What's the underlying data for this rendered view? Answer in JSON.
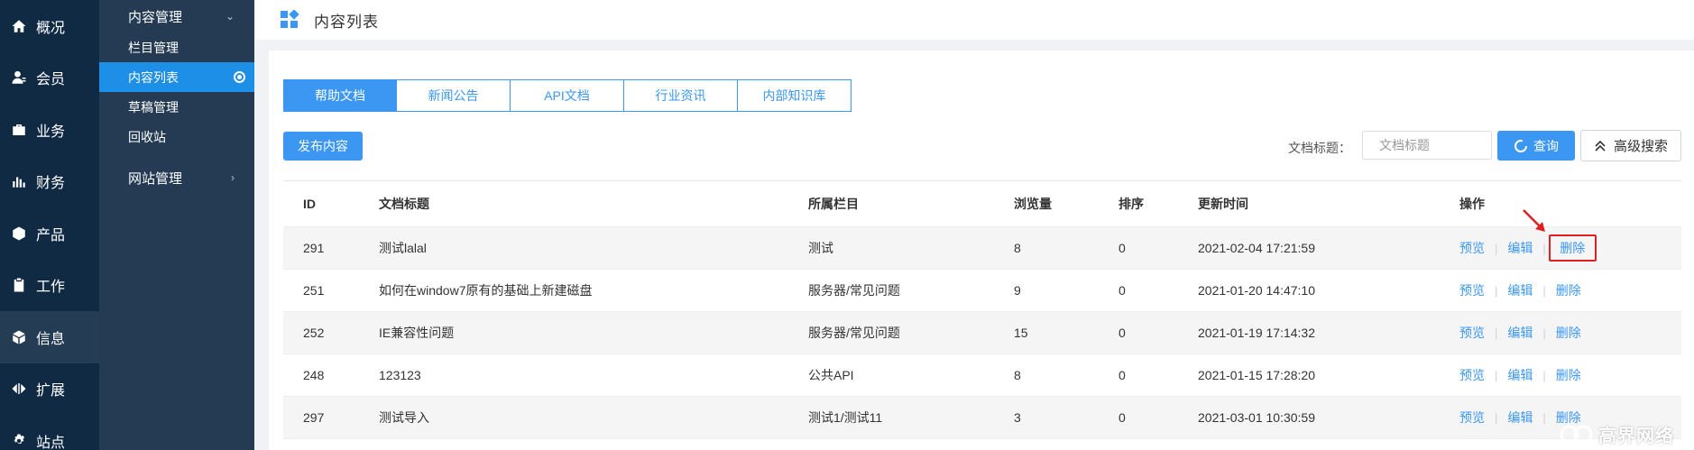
{
  "rail": [
    {
      "label": "概况",
      "icon": "home-icon"
    },
    {
      "label": "会员",
      "icon": "user-icon"
    },
    {
      "label": "业务",
      "icon": "briefcase-icon"
    },
    {
      "label": "财务",
      "icon": "bar-chart-icon"
    },
    {
      "label": "产品",
      "icon": "cube-icon"
    },
    {
      "label": "工作",
      "icon": "clipboard-icon"
    },
    {
      "label": "信息",
      "icon": "box-icon",
      "active": true
    },
    {
      "label": "扩展",
      "icon": "expand-icon"
    },
    {
      "label": "站点",
      "icon": "gear-icon"
    }
  ],
  "submenu": {
    "content_group": "内容管理",
    "items": [
      "栏目管理",
      "内容列表",
      "草稿管理",
      "回收站"
    ],
    "active_item": "内容列表",
    "site_group": "网站管理"
  },
  "header": {
    "title": "内容列表"
  },
  "tabs": [
    "帮助文档",
    "新闻公告",
    "API文档",
    "行业资讯",
    "内部知识库"
  ],
  "active_tab": "帮助文档",
  "toolbar": {
    "publish_label": "发布内容",
    "search_label": "文档标题：",
    "search_placeholder": "文档标题",
    "query_label": "查询",
    "advanced_label": "高级搜索"
  },
  "table": {
    "headers": [
      "ID",
      "文档标题",
      "所属栏目",
      "浏览量",
      "排序",
      "更新时间",
      "操作"
    ],
    "ops": {
      "preview": "预览",
      "edit": "编辑",
      "delete": "删除"
    },
    "rows": [
      {
        "id": "291",
        "title": "测试lalal",
        "column": "测试",
        "views": "8",
        "sort": "0",
        "time": "2021-02-04 17:21:59"
      },
      {
        "id": "251",
        "title": "如何在window7原有的基础上新建磁盘",
        "column": "服务器/常见问题",
        "views": "9",
        "sort": "0",
        "time": "2021-01-20 14:47:10"
      },
      {
        "id": "252",
        "title": "IE兼容性问题",
        "column": "服务器/常见问题",
        "views": "15",
        "sort": "0",
        "time": "2021-01-19 17:14:32"
      },
      {
        "id": "248",
        "title": "123123",
        "column": "公共API",
        "views": "8",
        "sort": "0",
        "time": "2021-01-15 17:28:20"
      },
      {
        "id": "297",
        "title": "测试导入",
        "column": "测试1/测试11",
        "views": "3",
        "sort": "0",
        "time": "2021-03-01 10:30:59"
      }
    ]
  },
  "watermark": "高界网络",
  "colors": {
    "accent": "#3b97f2",
    "rail_bg": "#102a44",
    "submenu_bg": "#243b53",
    "highlight": "#e02020"
  }
}
